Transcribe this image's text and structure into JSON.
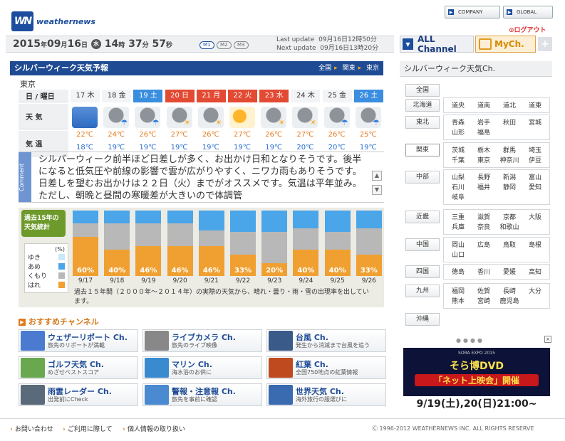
{
  "brand": {
    "logo_mark": "WN",
    "logo_text": "weathernews"
  },
  "top_nav": {
    "company": "COMPANY",
    "global": "GLOBAL",
    "logout": "ログアウト"
  },
  "datetime": {
    "year": "2015",
    "year_unit": "年",
    "month": "09",
    "month_unit": "月",
    "day": "16",
    "day_unit": "日",
    "weekday": "水",
    "hour": "14",
    "hour_unit": "時",
    "minute": "37",
    "minute_unit": "分",
    "second": "57",
    "second_unit": "秒"
  },
  "timezones": [
    "M1",
    "M2",
    "M3"
  ],
  "update": {
    "last_label": "Last update",
    "last_value": "09月16日12時50分",
    "next_label": "Next update",
    "next_value": "09月16日13時20分"
  },
  "channels": {
    "all": "ALL Channel",
    "my": "MyCh.",
    "plus": "+"
  },
  "forecast": {
    "title": "シルバーウィーク天気予報",
    "regions": [
      "全国",
      "関東",
      "東京"
    ],
    "city": "東京",
    "row_labels": {
      "date": "日 / 曜日",
      "weather": "天 気",
      "temp": "気 温"
    },
    "days": [
      {
        "date": "17 木",
        "type": "weekday",
        "icon": "rain-umbrella-icon",
        "max": "22℃",
        "min": "18℃"
      },
      {
        "date": "18 金",
        "type": "weekday",
        "icon": "cloudy-rain-icon",
        "max": "24℃",
        "min": "19℃"
      },
      {
        "date": "19 土",
        "type": "sat",
        "icon": "cloudy-rain-icon",
        "max": "26℃",
        "min": "19℃"
      },
      {
        "date": "20 日",
        "type": "sun",
        "icon": "cloudy-sun-icon",
        "max": "27℃",
        "min": "19℃"
      },
      {
        "date": "21 月",
        "type": "sun",
        "icon": "cloudy-sun-icon",
        "max": "26℃",
        "min": "19℃"
      },
      {
        "date": "22 火",
        "type": "sun",
        "icon": "sunny-cloud-icon",
        "max": "27℃",
        "min": "19℃"
      },
      {
        "date": "23 水",
        "type": "sun",
        "icon": "cloudy-sun-icon",
        "max": "26℃",
        "min": "19℃"
      },
      {
        "date": "24 木",
        "type": "weekday",
        "icon": "cloudy-sun-icon",
        "max": "27℃",
        "min": "20℃"
      },
      {
        "date": "25 金",
        "type": "weekday",
        "icon": "cloudy-rain-icon",
        "max": "26℃",
        "min": "20℃"
      },
      {
        "date": "26 土",
        "type": "sat",
        "icon": "cloudy-rain-icon",
        "max": "25℃",
        "min": "19℃"
      }
    ],
    "comment_label": "Comment",
    "comment": "シルバーウィーク前半ほど日差しが多く、お出かけ日和となりそうです。後半になると低気圧や前線の影響で雲が広がりやすく、ニワカ雨もありそうです。日差しを望むお出かけは２２日（火）までがオススメです。気温は平年並み。ただし、朝晩と昼間の寒暖差が大きいので体調管"
  },
  "stats": {
    "label": "過去15年の天気統計",
    "legend_unit": "(%)",
    "legend": [
      {
        "name": "ゆき",
        "color": "#c9e8f8"
      },
      {
        "name": "あめ",
        "color": "#4aa6e8"
      },
      {
        "name": "くもり",
        "color": "#b8b8b8"
      },
      {
        "name": "はれ",
        "color": "#f0a030"
      }
    ],
    "note": "過去１５年間（２０００年〜２０１４年）の実際の天気から、晴れ・曇り・雨・雪の出現率を出しています。"
  },
  "chart_data": {
    "type": "bar",
    "stacked": true,
    "categories": [
      "9/17",
      "9/18",
      "9/19",
      "9/20",
      "9/21",
      "9/22",
      "9/23",
      "9/24",
      "9/25",
      "9/26"
    ],
    "series": [
      {
        "name": "はれ",
        "values": [
          60,
          40,
          46,
          46,
          46,
          33,
          20,
          40,
          40,
          33
        ],
        "color": "#f0a030"
      },
      {
        "name": "くもり",
        "values": [
          20,
          40,
          34,
          34,
          24,
          34,
          47,
          33,
          27,
          40
        ],
        "color": "#b8b8b8"
      },
      {
        "name": "あめ",
        "values": [
          20,
          20,
          20,
          20,
          30,
          33,
          33,
          27,
          33,
          27
        ],
        "color": "#4aa6e8"
      },
      {
        "name": "ゆき",
        "values": [
          0,
          0,
          0,
          0,
          0,
          0,
          0,
          0,
          0,
          0
        ],
        "color": "#c9e8f8"
      }
    ],
    "data_labels": [
      "60%",
      "40%",
      "46%",
      "46%",
      "46%",
      "33%",
      "20%",
      "40%",
      "40%",
      "33%"
    ],
    "ylim": [
      0,
      100
    ]
  },
  "recommend": {
    "title": "おすすめチャンネル",
    "cards": [
      {
        "title": "ウェザーリポート Ch.",
        "sub": "旅先のリポートが満載",
        "thumb": "report-map-icon",
        "color": "#4a7bd0"
      },
      {
        "title": "ライブカメラ Ch.",
        "sub": "旅先のライブ映像",
        "thumb": "live-camera-icon",
        "color": "#888"
      },
      {
        "title": "台風 Ch.",
        "sub": "発生から消滅まで台風を追う",
        "thumb": "typhoon-icon",
        "color": "#3a5a8a"
      },
      {
        "title": "ゴルフ天気 Ch.",
        "sub": "めざせベストスコア",
        "thumb": "golf-icon",
        "color": "#6aa84f"
      },
      {
        "title": "マリン Ch.",
        "sub": "海水浴のお供に",
        "thumb": "marine-icon",
        "color": "#3a8ad0"
      },
      {
        "title": "紅葉 Ch.",
        "sub": "全国750地点の紅葉情報",
        "thumb": "autumn-leaf-icon",
        "color": "#c04a20"
      },
      {
        "title": "雨雲レーダー Ch.",
        "sub": "出発前にCheck",
        "thumb": "radar-icon",
        "color": "#5a6a7a"
      },
      {
        "title": "警報・注意報 Ch.",
        "sub": "旅先を事前に確認",
        "thumb": "warning-map-icon",
        "color": "#4a8ad0"
      },
      {
        "title": "世界天気 Ch.",
        "sub": "海外旅行の服選びに",
        "thumb": "world-map-icon",
        "color": "#3a6ab0"
      }
    ]
  },
  "right_panel": {
    "title": "シルバーウィーク天気Ch.",
    "national": "全国",
    "regions": [
      {
        "name": "北海道",
        "cities": [
          "道央",
          "道南",
          "道北",
          "道東"
        ]
      },
      {
        "name": "東北",
        "cities": [
          "青森",
          "岩手",
          "秋田",
          "宮城",
          "山形",
          "福島"
        ]
      },
      {
        "name": "関東",
        "cities": [
          "茨城",
          "栃木",
          "群馬",
          "埼玉",
          "千葉",
          "東京",
          "神奈川",
          "伊豆"
        ],
        "selected": true
      },
      {
        "name": "中部",
        "cities": [
          "山梨",
          "長野",
          "新潟",
          "富山",
          "石川",
          "福井",
          "静岡",
          "愛知",
          "岐阜"
        ]
      },
      {
        "name": "近畿",
        "cities": [
          "三重",
          "滋賀",
          "京都",
          "大阪",
          "兵庫",
          "奈良",
          "和歌山"
        ]
      },
      {
        "name": "中国",
        "cities": [
          "岡山",
          "広島",
          "鳥取",
          "島根",
          "山口"
        ]
      },
      {
        "name": "四国",
        "cities": [
          "徳島",
          "香川",
          "愛媛",
          "高知"
        ]
      },
      {
        "name": "九州",
        "cities": [
          "福岡",
          "佐賀",
          "長崎",
          "大分",
          "熊本",
          "宮崎",
          "鹿児島"
        ]
      },
      {
        "name": "沖縄",
        "cities": []
      }
    ],
    "banner": {
      "top": "SORA EXPO 2015",
      "line1": "そら博DVD",
      "line2": "「ネット上映会」開催",
      "line3": "9/19(土),20(日)21:00~"
    }
  },
  "footer": {
    "links": [
      "お問い合わせ",
      "ご利用に際して",
      "個人情報の取り扱い"
    ],
    "copyright": "Ⓒ 1996-2012 WEATHERNEWS INC. ALL RIGHTS RESERVE"
  }
}
